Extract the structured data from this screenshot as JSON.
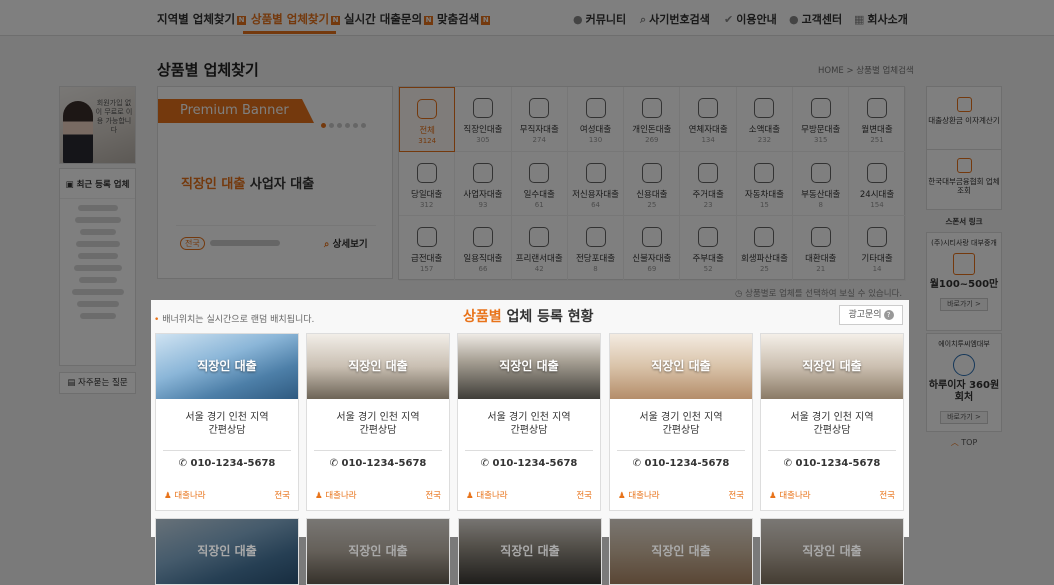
{
  "nav": {
    "items": [
      {
        "label": "지역별 업체찾기",
        "badge": "N"
      },
      {
        "label": "상품별 업체찾기",
        "badge": "N"
      },
      {
        "label": "실시간 대출문의",
        "badge": "N"
      },
      {
        "label": "맞춤검색",
        "badge": "N"
      }
    ],
    "utility": [
      {
        "label": "커뮤니티",
        "icon": "chat-icon"
      },
      {
        "label": "사기번호검색",
        "icon": "search-icon"
      },
      {
        "label": "이용안내",
        "icon": "check-icon"
      },
      {
        "label": "고객센터",
        "icon": "person-icon"
      },
      {
        "label": "회사소개",
        "icon": "building-icon"
      }
    ]
  },
  "page": {
    "title": "상품별 업체찾기",
    "breadcrumb": "HOME > 상품별 업체검색"
  },
  "left": {
    "ad_text": "회원가입 없이 무료로 이용 가능합니다",
    "recent_title": "최근 등록 업체",
    "faq": "자주묻는 질문"
  },
  "premium": {
    "label": "Premium Banner",
    "title_highlight": "직장인 대출",
    "title_rest": "사업자 대출",
    "region": "전국",
    "more": "상세보기"
  },
  "categories": [
    {
      "name": "전체",
      "count": "3124",
      "icon": "list-icon"
    },
    {
      "name": "직장인대출",
      "count": "305",
      "icon": "office-worker-icon"
    },
    {
      "name": "무직자대출",
      "count": "274",
      "icon": "person-icon"
    },
    {
      "name": "여성대출",
      "count": "130",
      "icon": "woman-icon"
    },
    {
      "name": "개인돈대출",
      "count": "269",
      "icon": "money-hand-icon"
    },
    {
      "name": "연체자대출",
      "count": "134",
      "icon": "clock-icon"
    },
    {
      "name": "소액대출",
      "count": "232",
      "icon": "coins-icon"
    },
    {
      "name": "무방문대출",
      "count": "315",
      "icon": "fax-icon"
    },
    {
      "name": "월변대출",
      "count": "251",
      "icon": "calendar-icon"
    },
    {
      "name": "당일대출",
      "count": "312",
      "icon": "sun-icon"
    },
    {
      "name": "사업자대출",
      "count": "93",
      "icon": "businessman-icon"
    },
    {
      "name": "일수대출",
      "count": "61",
      "icon": "calendar-1-icon"
    },
    {
      "name": "저신용자대출",
      "count": "64",
      "icon": "down-chart-icon"
    },
    {
      "name": "신용대출",
      "count": "25",
      "icon": "credit-card-icon"
    },
    {
      "name": "주거대출",
      "count": "23",
      "icon": "home-key-icon"
    },
    {
      "name": "자동차대출",
      "count": "15",
      "icon": "car-icon"
    },
    {
      "name": "부동산대출",
      "count": "8",
      "icon": "house-icon"
    },
    {
      "name": "24시대출",
      "count": "154",
      "icon": "24h-icon"
    },
    {
      "name": "급전대출",
      "count": "157",
      "icon": "cash-fast-icon"
    },
    {
      "name": "일용직대출",
      "count": "66",
      "icon": "worker-icon"
    },
    {
      "name": "프리랜서대출",
      "count": "42",
      "icon": "freelancer-icon"
    },
    {
      "name": "전당포대출",
      "count": "8",
      "icon": "pawnshop-icon"
    },
    {
      "name": "신불자대출",
      "count": "69",
      "icon": "bills-icon"
    },
    {
      "name": "주부대출",
      "count": "52",
      "icon": "housewife-icon"
    },
    {
      "name": "회생파산대출",
      "count": "25",
      "icon": "piggy-bank-icon"
    },
    {
      "name": "대환대출",
      "count": "21",
      "icon": "exchange-icon"
    },
    {
      "name": "기타대출",
      "count": "14",
      "icon": "more-icon"
    }
  ],
  "notice": "상품별로 업체를 선택하여 보실 수 있습니다.",
  "right": {
    "calc": "대출상환금 이자계산기",
    "lookup": "한국대부금융협회 업체조회",
    "sponsor_title": "스폰서 링크",
    "sponsor1": {
      "name": "(주)시티사랑 대부중개",
      "amount": "월100~500만",
      "cta": "바로가기 >"
    },
    "sponsor2": {
      "name": "에이치투씨엠대부",
      "amount": "하루이자 360원회처",
      "cta": "바로가기 >"
    },
    "top": "TOP"
  },
  "modal": {
    "note": "배너위치는 실시간으로 랜덤 배치됩니다.",
    "title_highlight": "상품별",
    "title_rest": "업체 등록 현황",
    "ad_button": "광고문의",
    "cards": [
      {
        "title": "직장인 대출",
        "desc1": "서울 경기 인천 지역",
        "desc2": "간편상담",
        "phone": "010-1234-5678",
        "company": "대출나라",
        "region": "전국"
      },
      {
        "title": "직장인 대출",
        "desc1": "서울 경기 인천 지역",
        "desc2": "간편상담",
        "phone": "010-1234-5678",
        "company": "대출나라",
        "region": "전국"
      },
      {
        "title": "직장인 대출",
        "desc1": "서울 경기 인천 지역",
        "desc2": "간편상담",
        "phone": "010-1234-5678",
        "company": "대출나라",
        "region": "전국"
      },
      {
        "title": "직장인 대출",
        "desc1": "서울 경기 인천 지역",
        "desc2": "간편상담",
        "phone": "010-1234-5678",
        "company": "대출나라",
        "region": "전국"
      },
      {
        "title": "직장인 대출",
        "desc1": "서울 경기 인천 지역",
        "desc2": "간편상담",
        "phone": "010-1234-5678",
        "company": "대출나라",
        "region": "전국"
      }
    ],
    "bottom_cards": [
      "직장인 대출",
      "직장인 대출",
      "직장인 대출",
      "직장인 대출",
      "직장인 대출"
    ]
  },
  "colors": {
    "accent": "#e8731a",
    "overlay": "rgba(0,0,0,0.5)"
  }
}
